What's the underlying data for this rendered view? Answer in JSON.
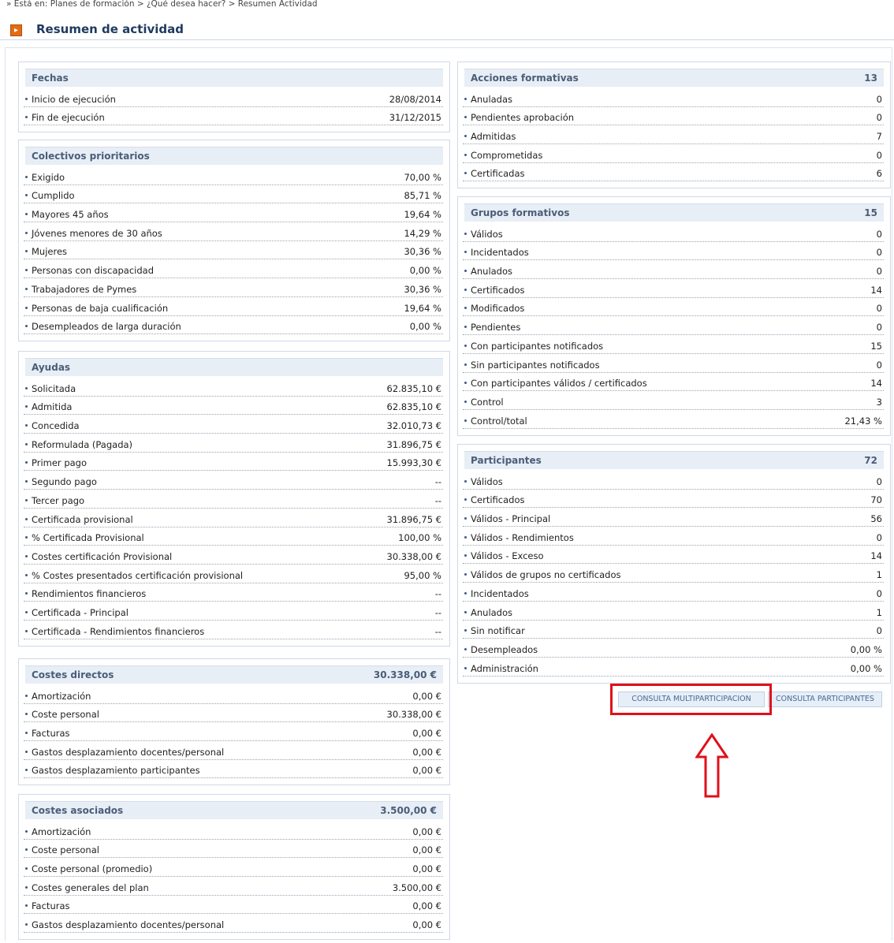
{
  "breadcrumb": "» Está en:   Planes de formación > ¿Qué desea hacer? > Resumen Actividad",
  "page_title": "Resumen de actividad",
  "title_icon": "arrow-right-box-icon",
  "left_panels": [
    {
      "title": "Fechas",
      "total": "",
      "rows": [
        {
          "label": "Inicio de ejecución",
          "value": "28/08/2014"
        },
        {
          "label": "Fin de ejecución",
          "value": "31/12/2015"
        }
      ]
    },
    {
      "title": "Colectivos prioritarios",
      "total": "",
      "rows": [
        {
          "label": "Exigido",
          "value": "70,00 %"
        },
        {
          "label": "Cumplido",
          "value": "85,71 %"
        },
        {
          "label": "Mayores 45 años",
          "value": "19,64 %"
        },
        {
          "label": "Jóvenes menores de 30 años",
          "value": "14,29 %"
        },
        {
          "label": "Mujeres",
          "value": "30,36 %"
        },
        {
          "label": "Personas con discapacidad",
          "value": "0,00 %"
        },
        {
          "label": "Trabajadores de Pymes",
          "value": "30,36 %"
        },
        {
          "label": "Personas de baja cualificación",
          "value": "19,64 %"
        },
        {
          "label": "Desempleados de larga duración",
          "value": "0,00 %"
        }
      ]
    },
    {
      "title": "Ayudas",
      "total": "",
      "rows": [
        {
          "label": "Solicitada",
          "value": "62.835,10 €"
        },
        {
          "label": "Admitida",
          "value": "62.835,10 €"
        },
        {
          "label": "Concedida",
          "value": "32.010,73 €"
        },
        {
          "label": "Reformulada (Pagada)",
          "value": "31.896,75 €"
        },
        {
          "label": "Primer pago",
          "value": "15.993,30 €"
        },
        {
          "label": "Segundo pago",
          "value": "--"
        },
        {
          "label": "Tercer pago",
          "value": "--"
        },
        {
          "label": "Certificada provisional",
          "value": "31.896,75 €"
        },
        {
          "label": "% Certificada Provisional",
          "value": "100,00 %"
        },
        {
          "label": "Costes certificación Provisional",
          "value": "30.338,00 €"
        },
        {
          "label": "% Costes presentados certificación provisional",
          "value": "95,00 %"
        },
        {
          "label": "Rendimientos financieros",
          "value": "--"
        },
        {
          "label": "Certificada - Principal",
          "value": "--"
        },
        {
          "label": "Certificada - Rendimientos financieros",
          "value": "--"
        }
      ]
    },
    {
      "title": "Costes directos",
      "total": "30.338,00 €",
      "rows": [
        {
          "label": "Amortización",
          "value": "0,00 €"
        },
        {
          "label": "Coste personal",
          "value": "30.338,00 €"
        },
        {
          "label": "Facturas",
          "value": "0,00 €"
        },
        {
          "label": "Gastos desplazamiento docentes/personal",
          "value": "0,00 €"
        },
        {
          "label": "Gastos desplazamiento participantes",
          "value": "0,00 €"
        }
      ]
    },
    {
      "title": "Costes asociados",
      "total": "3.500,00 €",
      "rows": [
        {
          "label": "Amortización",
          "value": "0,00 €"
        },
        {
          "label": "Coste personal",
          "value": "0,00 €"
        },
        {
          "label": "Coste personal (promedio)",
          "value": "0,00 €"
        },
        {
          "label": "Costes generales del plan",
          "value": "3.500,00 €"
        },
        {
          "label": "Facturas",
          "value": "0,00 €"
        },
        {
          "label": "Gastos desplazamiento docentes/personal",
          "value": "0,00 €"
        }
      ]
    }
  ],
  "right_panels": [
    {
      "title": "Acciones formativas",
      "total": "13",
      "rows": [
        {
          "label": "Anuladas",
          "value": "0"
        },
        {
          "label": "Pendientes aprobación",
          "value": "0"
        },
        {
          "label": "Admitidas",
          "value": "7"
        },
        {
          "label": "Comprometidas",
          "value": "0"
        },
        {
          "label": "Certificadas",
          "value": "6"
        }
      ]
    },
    {
      "title": "Grupos formativos",
      "total": "15",
      "rows": [
        {
          "label": "Válidos",
          "value": "0"
        },
        {
          "label": "Incidentados",
          "value": "0"
        },
        {
          "label": "Anulados",
          "value": "0"
        },
        {
          "label": "Certificados",
          "value": "14"
        },
        {
          "label": "Modificados",
          "value": "0"
        },
        {
          "label": "Pendientes",
          "value": "0"
        },
        {
          "label": "Con participantes notificados",
          "value": "15"
        },
        {
          "label": "Sin participantes notificados",
          "value": "0"
        },
        {
          "label": "Con participantes válidos / certificados",
          "value": "14"
        },
        {
          "label": "Control",
          "value": "3"
        },
        {
          "label": "Control/total",
          "value": "21,43 %"
        }
      ]
    },
    {
      "title": "Participantes",
      "total": "72",
      "rows": [
        {
          "label": "Válidos",
          "value": "0"
        },
        {
          "label": "Certificados",
          "value": "70"
        },
        {
          "label": "Válidos - Principal",
          "value": "56"
        },
        {
          "label": "Válidos - Rendimientos",
          "value": "0"
        },
        {
          "label": "Válidos - Exceso",
          "value": "14"
        },
        {
          "label": "Válidos de grupos no certificados",
          "value": "1"
        },
        {
          "label": "Incidentados",
          "value": "0"
        },
        {
          "label": "Anulados",
          "value": "1"
        },
        {
          "label": "Sin notificar",
          "value": "0"
        },
        {
          "label": "Desempleados",
          "value": "0,00 %"
        },
        {
          "label": "Administración",
          "value": "0,00 %"
        }
      ]
    }
  ],
  "buttons": {
    "multiparticipacion": "CONSULTA MULTIPARTICIPACION",
    "participantes": "CONSULTA PARTICIPANTES"
  },
  "annotation": {
    "highlight_color": "#e0101a",
    "arrow_icon": "up-arrow-outline-icon"
  }
}
